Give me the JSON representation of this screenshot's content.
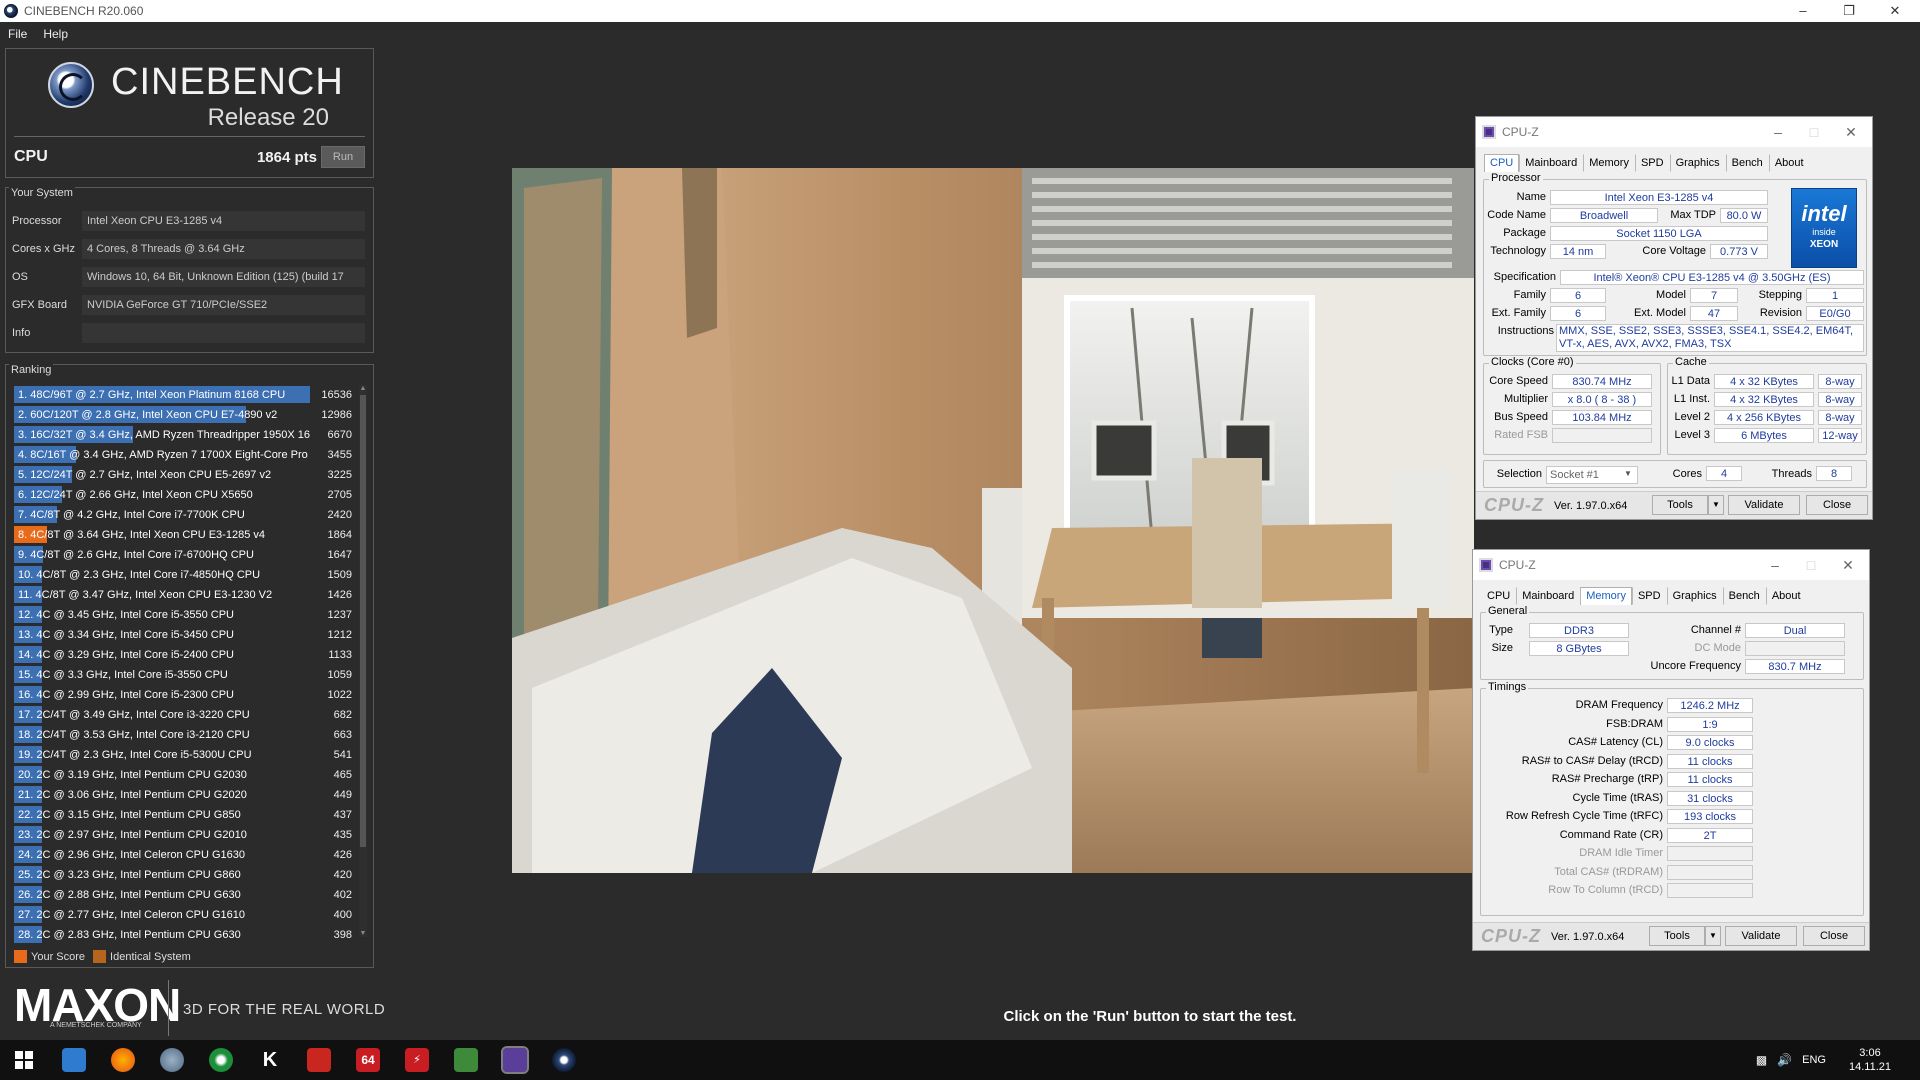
{
  "window": {
    "title": "CINEBENCH R20.060"
  },
  "menu": [
    "File",
    "Help"
  ],
  "logo": {
    "brand": "CINEBENCH",
    "release": "Release 20"
  },
  "cpu_test": {
    "label": "CPU",
    "score": "1864 pts",
    "run_label": "Run"
  },
  "your_system": {
    "title": "Your System",
    "rows": [
      {
        "label": "Processor",
        "value": "Intel Xeon CPU E3-1285 v4"
      },
      {
        "label": "Cores x GHz",
        "value": "4 Cores, 8 Threads @ 3.64 GHz"
      },
      {
        "label": "OS",
        "value": "Windows 10, 64 Bit, Unknown Edition (125) (build 17"
      },
      {
        "label": "GFX Board",
        "value": "NVIDIA GeForce GT 710/PCIe/SSE2"
      },
      {
        "label": "Info",
        "value": ""
      }
    ]
  },
  "ranking": {
    "title": "Ranking",
    "items": [
      {
        "name": "1. 48C/96T @ 2.7 GHz, Intel Xeon Platinum 8168 CPU",
        "score": 16536,
        "mine": false
      },
      {
        "name": "2. 60C/120T @ 2.8 GHz, Intel Xeon CPU E7-4890 v2",
        "score": 12986,
        "mine": false
      },
      {
        "name": "3. 16C/32T @ 3.4 GHz, AMD Ryzen Threadripper 1950X 16",
        "score": 6670,
        "mine": false
      },
      {
        "name": "4. 8C/16T @ 3.4 GHz, AMD Ryzen 7 1700X Eight-Core Pro",
        "score": 3455,
        "mine": false
      },
      {
        "name": "5. 12C/24T @ 2.7 GHz, Intel Xeon CPU E5-2697 v2",
        "score": 3225,
        "mine": false
      },
      {
        "name": "6. 12C/24T @ 2.66 GHz, Intel Xeon CPU X5650",
        "score": 2705,
        "mine": false
      },
      {
        "name": "7. 4C/8T @ 4.2 GHz, Intel Core i7-7700K CPU",
        "score": 2420,
        "mine": false
      },
      {
        "name": "8. 4C/8T @ 3.64 GHz, Intel Xeon CPU E3-1285 v4",
        "score": 1864,
        "mine": true
      },
      {
        "name": "9. 4C/8T @ 2.6 GHz, Intel Core i7-6700HQ CPU",
        "score": 1647,
        "mine": false
      },
      {
        "name": "10. 4C/8T @ 2.3 GHz, Intel Core i7-4850HQ CPU",
        "score": 1509,
        "mine": false
      },
      {
        "name": "11. 4C/8T @ 3.47 GHz, Intel Xeon CPU E3-1230 V2",
        "score": 1426,
        "mine": false
      },
      {
        "name": "12. 4C @ 3.45 GHz, Intel Core i5-3550 CPU",
        "score": 1237,
        "mine": false
      },
      {
        "name": "13. 4C @ 3.34 GHz, Intel Core i5-3450 CPU",
        "score": 1212,
        "mine": false
      },
      {
        "name": "14. 4C @ 3.29 GHz, Intel Core i5-2400 CPU",
        "score": 1133,
        "mine": false
      },
      {
        "name": "15. 4C @ 3.3 GHz, Intel Core i5-3550 CPU",
        "score": 1059,
        "mine": false
      },
      {
        "name": "16. 4C @ 2.99 GHz, Intel Core i5-2300 CPU",
        "score": 1022,
        "mine": false
      },
      {
        "name": "17. 2C/4T @ 3.49 GHz, Intel Core i3-3220 CPU",
        "score": 682,
        "mine": false
      },
      {
        "name": "18. 2C/4T @ 3.53 GHz, Intel Core i3-2120 CPU",
        "score": 663,
        "mine": false
      },
      {
        "name": "19. 2C/4T @ 2.3 GHz, Intel Core i5-5300U CPU",
        "score": 541,
        "mine": false
      },
      {
        "name": "20. 2C @ 3.19 GHz, Intel Pentium CPU G2030",
        "score": 465,
        "mine": false
      },
      {
        "name": "21. 2C @ 3.06 GHz, Intel Pentium CPU G2020",
        "score": 449,
        "mine": false
      },
      {
        "name": "22. 2C @ 3.15 GHz, Intel Pentium CPU G850",
        "score": 437,
        "mine": false
      },
      {
        "name": "23. 2C @ 2.97 GHz, Intel Pentium CPU G2010",
        "score": 435,
        "mine": false
      },
      {
        "name": "24. 2C @ 2.96 GHz, Intel Celeron CPU G1630",
        "score": 426,
        "mine": false
      },
      {
        "name": "25. 2C @ 3.23 GHz, Intel Pentium CPU G860",
        "score": 420,
        "mine": false
      },
      {
        "name": "26. 2C @ 2.88 GHz, Intel Pentium CPU G630",
        "score": 402,
        "mine": false
      },
      {
        "name": "27. 2C @ 2.77 GHz, Intel Celeron CPU G1610",
        "score": 400,
        "mine": false
      },
      {
        "name": "28. 2C @ 2.83 GHz, Intel Pentium CPU G630",
        "score": 398,
        "mine": false
      }
    ],
    "legend": {
      "your_score": "Your Score",
      "identical": "Identical System"
    }
  },
  "maxon": {
    "logo": "MAXON",
    "sub": "A NEMETSCHEK COMPANY",
    "tagline": "3D FOR THE REAL WORLD"
  },
  "instruction": "Click on the 'Run' button to start the test.",
  "cpuz_cpu": {
    "title": "CPU-Z",
    "tabs": [
      "CPU",
      "Mainboard",
      "Memory",
      "SPD",
      "Graphics",
      "Bench",
      "About"
    ],
    "active_tab": "CPU",
    "processor": {
      "group": "Processor",
      "name_label": "Name",
      "name": "Intel Xeon E3-1285 v4",
      "codename_label": "Code Name",
      "codename": "Broadwell",
      "maxtdp_label": "Max TDP",
      "maxtdp": "80.0 W",
      "package_label": "Package",
      "package": "Socket 1150 LGA",
      "technology_label": "Technology",
      "technology": "14 nm",
      "voltage_label": "Core Voltage",
      "voltage": "0.773 V",
      "spec_label": "Specification",
      "spec": "Intel® Xeon® CPU E3-1285 v4 @ 3.50GHz (ES)",
      "family_label": "Family",
      "family": "6",
      "model_label": "Model",
      "model": "7",
      "stepping_label": "Stepping",
      "stepping": "1",
      "extfamily_label": "Ext. Family",
      "extfamily": "6",
      "extmodel_label": "Ext. Model",
      "extmodel": "47",
      "revision_label": "Revision",
      "revision": "E0/G0",
      "instr_label": "Instructions",
      "instr": "MMX, SSE, SSE2, SSE3, SSSE3, SSE4.1, SSE4.2, EM64T, VT-x, AES, AVX, AVX2, FMA3, TSX"
    },
    "intel": {
      "l1": "intel",
      "l2": "inside",
      "l3": "XEON"
    },
    "clocks": {
      "group": "Clocks (Core #0)",
      "core_speed_label": "Core Speed",
      "core_speed": "830.74 MHz",
      "multiplier_label": "Multiplier",
      "multiplier": "x 8.0 ( 8 - 38 )",
      "bus_label": "Bus Speed",
      "bus": "103.84 MHz",
      "fsb_label": "Rated FSB",
      "fsb": ""
    },
    "cache": {
      "group": "Cache",
      "l1d_label": "L1 Data",
      "l1d": "4 x 32 KBytes",
      "l1d_way": "8-way",
      "l1i_label": "L1 Inst.",
      "l1i": "4 x 32 KBytes",
      "l1i_way": "8-way",
      "l2_label": "Level 2",
      "l2": "4 x 256 KBytes",
      "l2_way": "8-way",
      "l3_label": "Level 3",
      "l3": "6 MBytes",
      "l3_way": "12-way"
    },
    "selection_label": "Selection",
    "selection": "Socket #1",
    "cores_label": "Cores",
    "cores": "4",
    "threads_label": "Threads",
    "threads": "8",
    "logo": "CPU-Z",
    "version": "Ver. 1.97.0.x64",
    "tools": "Tools",
    "validate": "Validate",
    "close": "Close"
  },
  "cpuz_mem": {
    "title": "CPU-Z",
    "tabs": [
      "CPU",
      "Mainboard",
      "Memory",
      "SPD",
      "Graphics",
      "Bench",
      "About"
    ],
    "active_tab": "Memory",
    "general": {
      "group": "General",
      "type_label": "Type",
      "type": "DDR3",
      "size_label": "Size",
      "size": "8 GBytes",
      "channel_label": "Channel #",
      "channel": "Dual",
      "dcmode_label": "DC Mode",
      "dcmode": "",
      "uncore_label": "Uncore Frequency",
      "uncore": "830.7 MHz"
    },
    "timings": {
      "group": "Timings",
      "rows": [
        {
          "label": "DRAM Frequency",
          "value": "1246.2 MHz",
          "dim": false
        },
        {
          "label": "FSB:DRAM",
          "value": "1:9",
          "dim": false
        },
        {
          "label": "CAS# Latency (CL)",
          "value": "9.0 clocks",
          "dim": false
        },
        {
          "label": "RAS# to CAS# Delay (tRCD)",
          "value": "11 clocks",
          "dim": false
        },
        {
          "label": "RAS# Precharge (tRP)",
          "value": "11 clocks",
          "dim": false
        },
        {
          "label": "Cycle Time (tRAS)",
          "value": "31 clocks",
          "dim": false
        },
        {
          "label": "Row Refresh Cycle Time (tRFC)",
          "value": "193 clocks",
          "dim": false
        },
        {
          "label": "Command Rate (CR)",
          "value": "2T",
          "dim": false
        },
        {
          "label": "DRAM Idle Timer",
          "value": "",
          "dim": true
        },
        {
          "label": "Total CAS# (tRDRAM)",
          "value": "",
          "dim": true
        },
        {
          "label": "Row To Column (tRCD)",
          "value": "",
          "dim": true
        }
      ]
    },
    "logo": "CPU-Z",
    "version": "Ver. 1.97.0.x64",
    "tools": "Tools",
    "validate": "Validate",
    "close": "Close"
  },
  "tray": {
    "lang": "ENG",
    "time": "3:06",
    "date": "14.11.21"
  },
  "colors": {
    "rank_bar": "#3d70b3",
    "rank_mine": "#e86b1c",
    "identical": "#b5651d",
    "cpuz_value": "#1f3c9e"
  }
}
